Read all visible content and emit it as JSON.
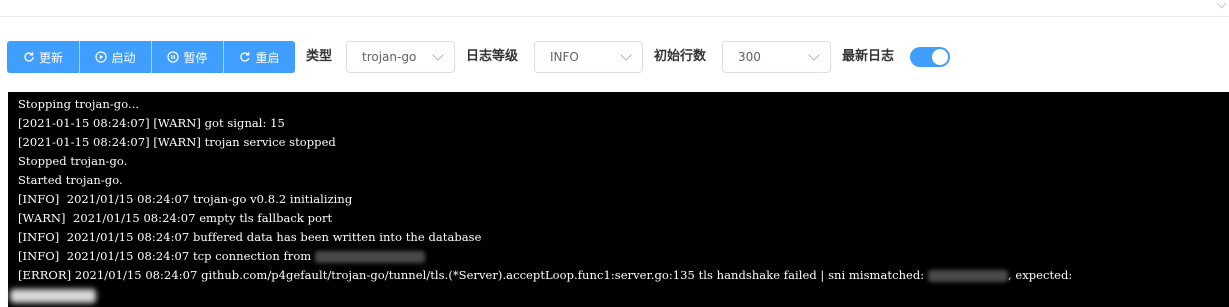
{
  "toolbar": {
    "refresh_label": "更新",
    "start_label": "启动",
    "pause_label": "暂停",
    "restart_label": "重启",
    "type_label": "类型",
    "type_value": "trojan-go",
    "log_level_label": "日志等级",
    "log_level_value": "INFO",
    "initial_lines_label": "初始行数",
    "initial_lines_value": "300",
    "latest_log_label": "最新日志",
    "latest_log_enabled": true
  },
  "colors": {
    "accent": "#409eff",
    "console_bg": "#000000",
    "console_text": "#ffffff"
  },
  "console": {
    "lines": [
      "Stopping trojan-go...",
      "[2021-01-15 08:24:07] [WARN] got signal: 15",
      "[2021-01-15 08:24:07] [WARN] trojan service stopped",
      "Stopped trojan-go.",
      "Started trojan-go.",
      "[INFO]  2021/01/15 08:24:07 trojan-go v0.8.2 initializing",
      "[WARN]  2021/01/15 08:24:07 empty tls fallback port",
      "[INFO]  2021/01/15 08:24:07 buffered data has been written into the database",
      "[INFO]  2021/01/15 08:24:07 tcp connection from"
    ],
    "error_line_prefix": "[ERROR] 2021/01/15 08:24:07 github.com/p4gefault/trojan-go/tunnel/tls.(*Server).acceptLoop.func1:server.go:135 tls handshake failed | sni mismatched:",
    "error_line_suffix": ", expected:"
  }
}
